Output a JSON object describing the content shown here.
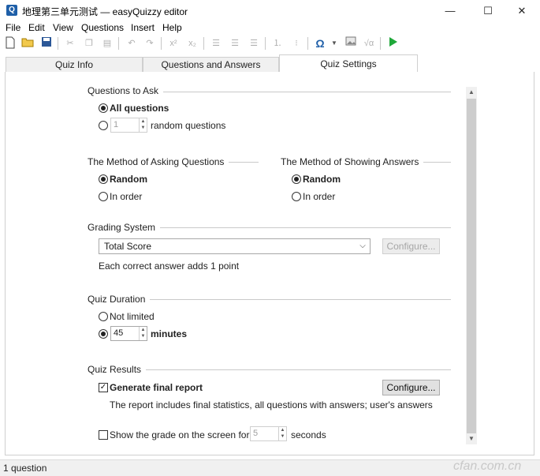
{
  "window": {
    "title": "地理第三单元测试 — easyQuizzy editor",
    "app_icon": "Q",
    "minimize": "—",
    "maximize": "☐",
    "close": "✕"
  },
  "menu": [
    "File",
    "Edit",
    "View",
    "Questions",
    "Insert",
    "Help"
  ],
  "tabs": [
    {
      "label": "Quiz Info"
    },
    {
      "label": "Questions and Answers"
    },
    {
      "label": "Quiz Settings"
    }
  ],
  "questions_to_ask": {
    "header": "Questions to Ask",
    "all_label": "All questions",
    "random_count": "1",
    "random_label": "random questions"
  },
  "asking_method": {
    "header": "The Method of Asking Questions",
    "options": [
      "Random",
      "In order"
    ]
  },
  "showing_method": {
    "header": "The Method of Showing Answers",
    "options": [
      "Random",
      "In order"
    ]
  },
  "grading": {
    "header": "Grading System",
    "selected": "Total Score",
    "configure_label": "Configure...",
    "note": "Each correct answer adds 1 point"
  },
  "duration": {
    "header": "Quiz Duration",
    "not_limited_label": "Not limited",
    "minutes_value": "45",
    "minutes_label": "minutes"
  },
  "results": {
    "header": "Quiz Results",
    "final_report_label": "Generate final report",
    "configure_label": "Configure...",
    "description": "The report includes final statistics, all questions with answers; user's answers",
    "show_grade_label": "Show the grade on the screen for",
    "seconds_value": "5",
    "seconds_label": "seconds"
  },
  "status": {
    "text": "1 question"
  },
  "watermark": "cfan.com.cn"
}
